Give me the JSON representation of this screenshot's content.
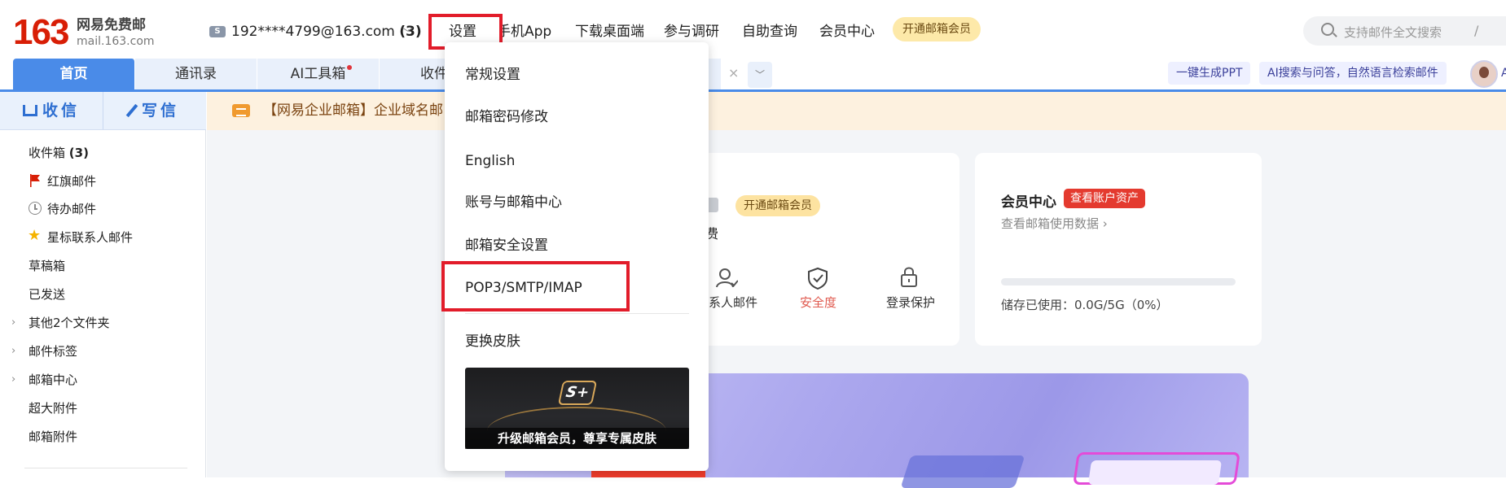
{
  "brand": {
    "logo_number": "163",
    "logo_title": "网易免费邮",
    "logo_domain": "mail.163.com"
  },
  "account": {
    "icon_letter": "S",
    "email": "192****4799@163.com",
    "unread": "(3)",
    "chevron": "﹀"
  },
  "topnav": {
    "settings": "设置",
    "mobile_app": "手机App",
    "desktop": "下载桌面端",
    "survey": "参与调研",
    "self_service": "自助查询",
    "member_center": "会员中心",
    "vip_pill": "开通邮箱会员"
  },
  "search": {
    "placeholder": "支持邮件全文搜索",
    "slash": "/"
  },
  "tabs": {
    "home": "首页",
    "contacts": "通讯录",
    "ai_tools": "AI工具箱",
    "inbox_partial": "收件",
    "close": "×",
    "more": "﹀"
  },
  "chips": {
    "ppt": "一键生成PPT",
    "ai_search": "AI搜索与问答，自然语言检索邮件",
    "avatar_letter": "A"
  },
  "sidebar": {
    "receive": "收信",
    "compose": "写信",
    "items": {
      "inbox": "收件箱",
      "inbox_count": "(3)",
      "flagged": "红旗邮件",
      "todo": "待办邮件",
      "starred": "星标联系人邮件",
      "drafts": "草稿箱",
      "sent": "已发送",
      "other_folders": "其他2个文件夹",
      "labels": "邮件标签",
      "mail_center": "邮箱中心",
      "big_attach": "超大附件",
      "attachments": "邮箱附件"
    }
  },
  "notice": {
    "text": "【网易企业邮箱】企业域名邮"
  },
  "card_left": {
    "vip_pill": "开通邮箱会员",
    "partial_text": "费",
    "quick": {
      "contacts_mail": "系人邮件",
      "security": "安全度",
      "login_protect": "登录保护"
    }
  },
  "card_right": {
    "title": "会员中心",
    "badge": "查看账户资产",
    "link": "查看邮箱使用数据 ›",
    "storage_text": "储存已使用：0.0G/5G（0%）",
    "storage_fraction": 0
  },
  "dropdown": {
    "items": [
      "常规设置",
      "邮箱密码修改",
      "English",
      "账号与邮箱中心",
      "邮箱安全设置",
      "POP3/SMTP/IMAP",
      "更换皮肤"
    ],
    "skin_caption": "升级邮箱会员，尊享专属皮肤",
    "skin_logo": "S+"
  },
  "colors": {
    "accent": "#4a8be8",
    "highlight": "#e21c2a",
    "brand_red": "#d81e06"
  }
}
